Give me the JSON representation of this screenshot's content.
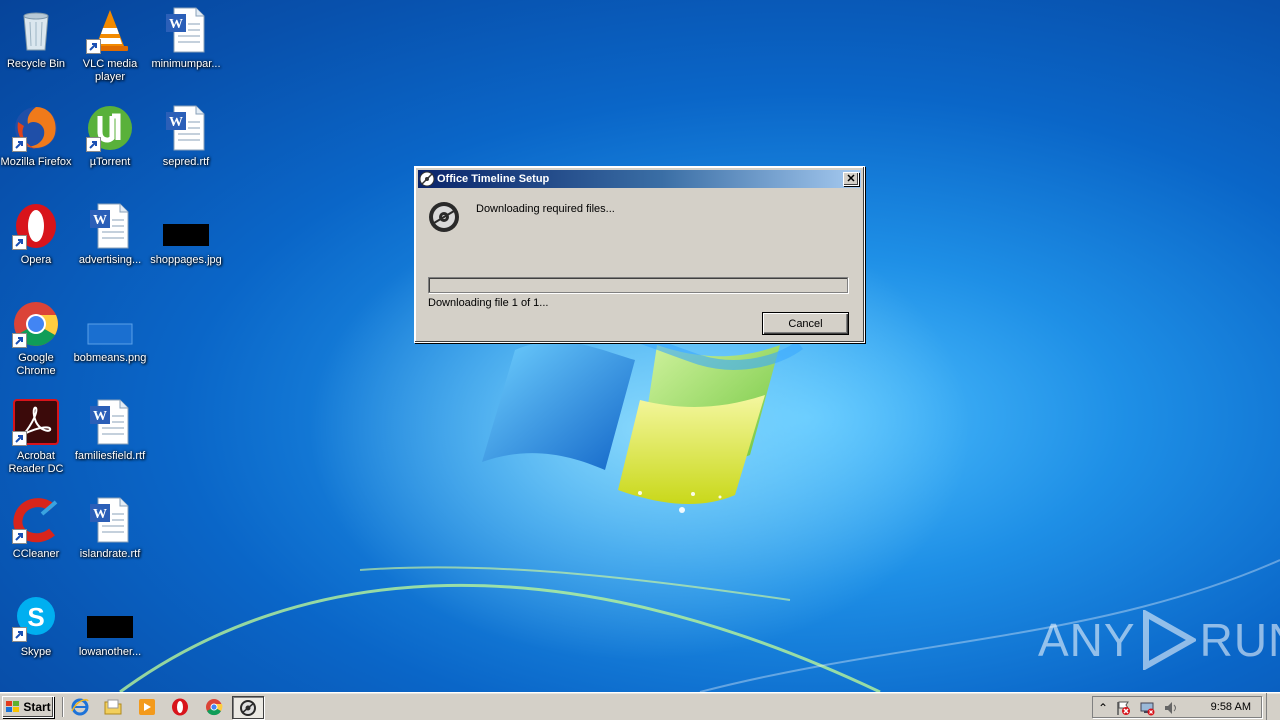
{
  "desktop": {
    "icons": [
      {
        "label": "Recycle Bin",
        "icon": "recycle-bin-icon"
      },
      {
        "label": "VLC media player",
        "icon": "vlc-icon"
      },
      {
        "label": "minimumpar...",
        "icon": "word-document-icon"
      },
      {
        "label": "Mozilla Firefox",
        "icon": "firefox-icon"
      },
      {
        "label": "µTorrent",
        "icon": "utorrent-icon"
      },
      {
        "label": "sepred.rtf",
        "icon": "word-document-icon"
      },
      {
        "label": "Opera",
        "icon": "opera-icon"
      },
      {
        "label": "advertising...",
        "icon": "word-document-icon"
      },
      {
        "label": "shoppages.jpg",
        "icon": "image-thumbnail-icon"
      },
      {
        "label": "Google Chrome",
        "icon": "chrome-icon"
      },
      {
        "label": "bobmeans.png",
        "icon": "image-thumbnail-icon"
      },
      {
        "label": "Acrobat Reader DC",
        "icon": "acrobat-icon"
      },
      {
        "label": "familiesfield.rtf",
        "icon": "word-document-icon"
      },
      {
        "label": "CCleaner",
        "icon": "ccleaner-icon"
      },
      {
        "label": "islandrate.rtf",
        "icon": "word-document-icon"
      },
      {
        "label": "Skype",
        "icon": "skype-icon"
      },
      {
        "label": "lowanother...",
        "icon": "image-thumbnail-icon"
      }
    ]
  },
  "dialog": {
    "title": "Office Timeline Setup",
    "close_label": "✕",
    "message": "Downloading required files...",
    "progress_fraction": 0.0,
    "status": "Downloading file 1 of 1...",
    "cancel_label": "Cancel"
  },
  "watermark": {
    "left": "ANY",
    "right": "RUN"
  },
  "taskbar": {
    "start_label": "Start",
    "pinned": [
      "internet-explorer-icon",
      "folder-icon",
      "media-player-icon",
      "opera-icon",
      "chrome-icon"
    ],
    "active": "office-timeline-setup-icon",
    "clock": "9:58 AM"
  },
  "colors": {
    "title_gradient_start": "#0a246a",
    "title_gradient_end": "#a6caf0",
    "dialog_face": "#d4d0c8"
  }
}
